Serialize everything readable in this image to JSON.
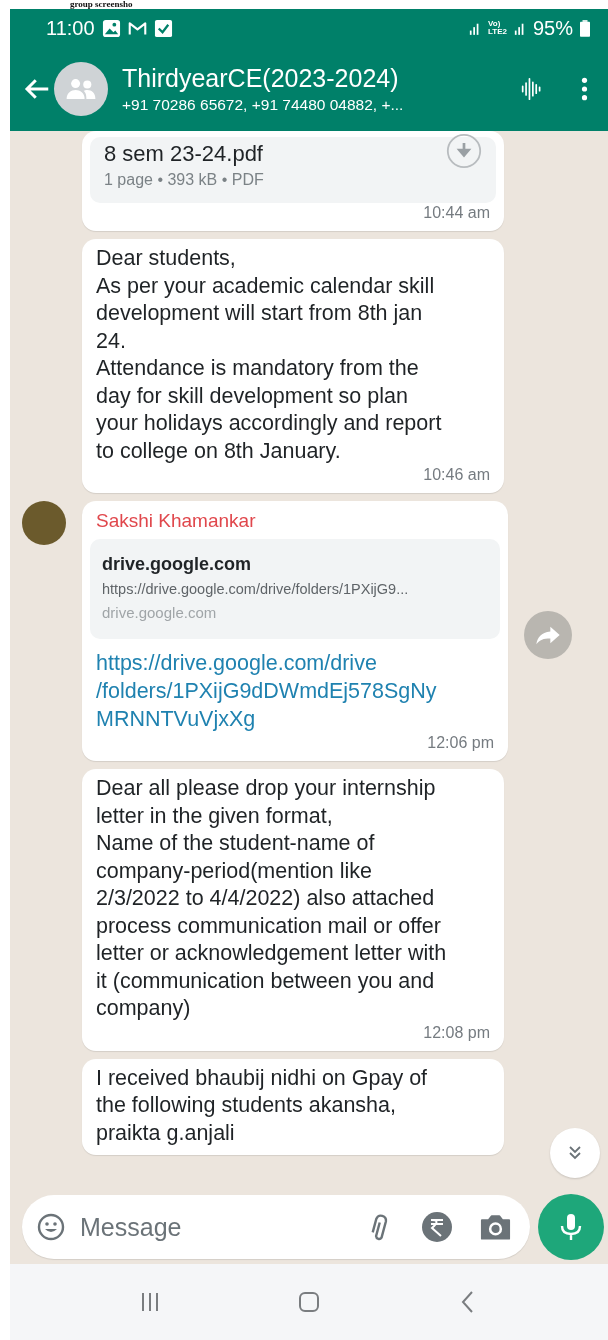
{
  "caption": "group screensho",
  "status_bar": {
    "time": "11:00",
    "network_lines": [
      "Vo)",
      "LTE2"
    ],
    "battery": "95%"
  },
  "chat_header": {
    "title": "ThirdyearCE(2023-2024)",
    "subtitle": "+91 70286 65672, +91 74480 04882, +..."
  },
  "messages": [
    {
      "kind": "document",
      "file_name": "8 sem 23-24.pdf",
      "file_meta": "1 page • 393 kB • PDF",
      "time": "10:44 am"
    },
    {
      "kind": "text",
      "text": "Dear students,\nAs per your academic calendar skill\ndevelopment will start from 8th jan\n24.\nAttendance is mandatory from the\nday for skill development so plan\nyour holidays accordingly and report\nto college on 8th January.",
      "time": "10:46 am"
    },
    {
      "kind": "link",
      "sender": "Sakshi Khamankar",
      "color": "#e0474c",
      "preview_title": "drive.google.com",
      "preview_url": "https://drive.google.com/drive/folders/1PXijG9...",
      "preview_domain": "drive.google.com",
      "link": "https://drive.google.com/drive\n/folders/1PXijG9dDWmdEj578SgNy\nMRNNTVuVjxXg",
      "time": "12:06 pm"
    },
    {
      "kind": "text",
      "text": "Dear all please drop your internship\nletter in the given format,\nName of the student-name of\ncompany-period(mention like\n2/3/2022 to 4/4/2022) also attached\nprocess communication mail or offer\nletter or acknowledgement letter with\nit (communication between you and\ncompany)",
      "time": "12:08 pm"
    },
    {
      "kind": "text",
      "text": "I received bhaubij nidhi on Gpay of\nthe following students akansha,\npraikta g.anjali"
    }
  ],
  "composer": {
    "placeholder": "Message"
  }
}
